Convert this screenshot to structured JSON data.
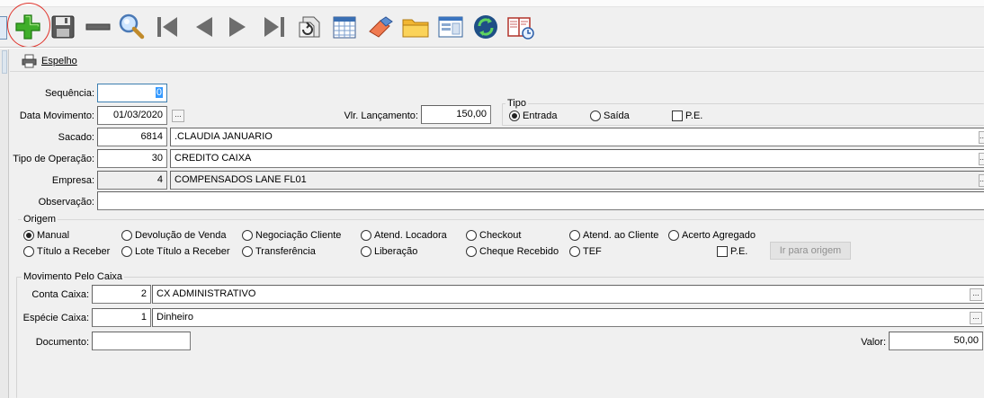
{
  "toolbar": {
    "icons": [
      "new-icon",
      "save-icon",
      "delete-icon",
      "search-icon",
      "first-icon",
      "previous-icon",
      "next-icon",
      "last-icon",
      "refresh-icon",
      "calendar-icon",
      "clear-icon",
      "folder-icon",
      "window-icon",
      "sync-icon",
      "report-icon"
    ]
  },
  "espelho": {
    "label": "Espelho"
  },
  "form": {
    "sequencia": {
      "label": "Sequência:",
      "value": "0"
    },
    "data_movimento": {
      "label": "Data Movimento:",
      "value": "01/03/2020",
      "button": "..."
    },
    "vlr_lancamento": {
      "label": "Vlr. Lançamento:",
      "value": "150,00"
    },
    "tipo": {
      "title": "Tipo",
      "options": [
        {
          "label": "Entrada",
          "selected": true
        },
        {
          "label": "Saída",
          "selected": false
        }
      ],
      "pe_label": "P.E."
    },
    "sacado": {
      "label": "Sacado:",
      "code": "6814",
      "name": ".CLAUDIA JANUARIO",
      "button": "..."
    },
    "tipo_operacao": {
      "label": "Tipo de Operação:",
      "code": "30",
      "name": "CREDITO CAIXA",
      "button": "..."
    },
    "empresa": {
      "label": "Empresa:",
      "code": "4",
      "name": "COMPENSADOS LANE FL01",
      "button": "..."
    },
    "observacao": {
      "label": "Observação:",
      "value": ""
    }
  },
  "origem": {
    "title": "Origem",
    "row1": [
      {
        "label": "Manual",
        "selected": true
      },
      {
        "label": "Devolução de Venda",
        "selected": false
      },
      {
        "label": "Negociação Cliente",
        "selected": false
      },
      {
        "label": "Atend. Locadora",
        "selected": false
      },
      {
        "label": "Checkout",
        "selected": false
      },
      {
        "label": "Atend. ao Cliente",
        "selected": false
      },
      {
        "label": "Acerto Agregado",
        "selected": false
      }
    ],
    "row2": [
      {
        "label": "Título a Receber",
        "selected": false
      },
      {
        "label": "Lote Título a Receber",
        "selected": false
      },
      {
        "label": "Transferência",
        "selected": false
      },
      {
        "label": "Liberação",
        "selected": false
      },
      {
        "label": "Cheque Recebido",
        "selected": false
      },
      {
        "label": "TEF",
        "selected": false
      }
    ],
    "pe_label": "P.E.",
    "goto_button": "Ir para origem"
  },
  "movimento": {
    "title": "Movimento Pelo Caixa",
    "conta_caixa": {
      "label": "Conta Caixa:",
      "code": "2",
      "name": "CX ADMINISTRATIVO",
      "button": "..."
    },
    "especie_caixa": {
      "label": "Espécie Caixa:",
      "code": "1",
      "name": "Dinheiro",
      "button": "..."
    },
    "documento": {
      "label": "Documento:",
      "value": ""
    },
    "valor": {
      "label": "Valor:",
      "value": "50,00"
    }
  },
  "colors": {
    "highlight_circle": "#e0342c",
    "selection": "#3399ff",
    "focus_border": "#3c7fb1"
  }
}
